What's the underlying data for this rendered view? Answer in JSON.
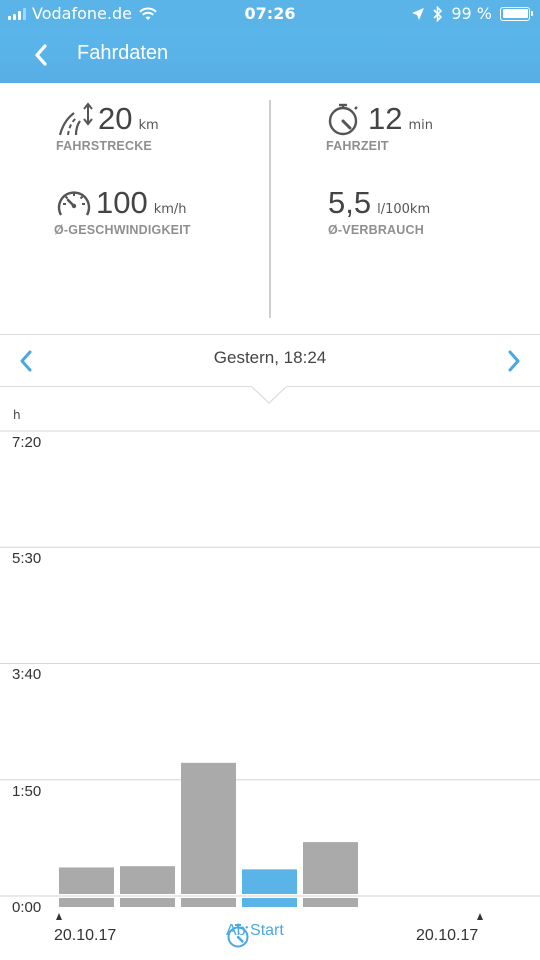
{
  "status_bar": {
    "carrier": "Vodafone.de",
    "time": "07:26",
    "battery": "99 %"
  },
  "header": {
    "title": "Fahrdaten"
  },
  "stats": {
    "distance": {
      "value": "20",
      "unit": "km",
      "label": "FAHRSTRECKE",
      "icon": "distance-road-icon"
    },
    "duration": {
      "value": "12",
      "unit": "min",
      "label": "FAHRZEIT",
      "icon": "stopwatch-icon"
    },
    "speed": {
      "value": "100",
      "unit": "km/h",
      "label": "Ø-GESCHWINDIGKEIT",
      "icon": "speedometer-icon"
    },
    "consumption": {
      "value": "5,5",
      "unit": "l/100km",
      "label": "Ø-VERBRAUCH"
    }
  },
  "date_selector": {
    "current": "Gestern, 18:24"
  },
  "chart_data": {
    "type": "bar",
    "y_unit": "h",
    "y_ticks": [
      "7:20",
      "5:30",
      "3:40",
      "1:50",
      "0:00"
    ],
    "y_tick_hours": [
      7.333,
      5.5,
      3.667,
      1.833,
      0
    ],
    "ylim_hours": [
      0,
      7.333
    ],
    "x_start_label": "20.10.17",
    "x_end_label": "20.10.17",
    "selected_index": 3,
    "values_hours": [
      0.45,
      0.47,
      2.1,
      0.42,
      0.85
    ],
    "bar_color": "#aaaaaa",
    "selected_color": "#5ab4e8",
    "grid": true
  },
  "footer": {
    "ab_start_label": "Ab Start"
  }
}
